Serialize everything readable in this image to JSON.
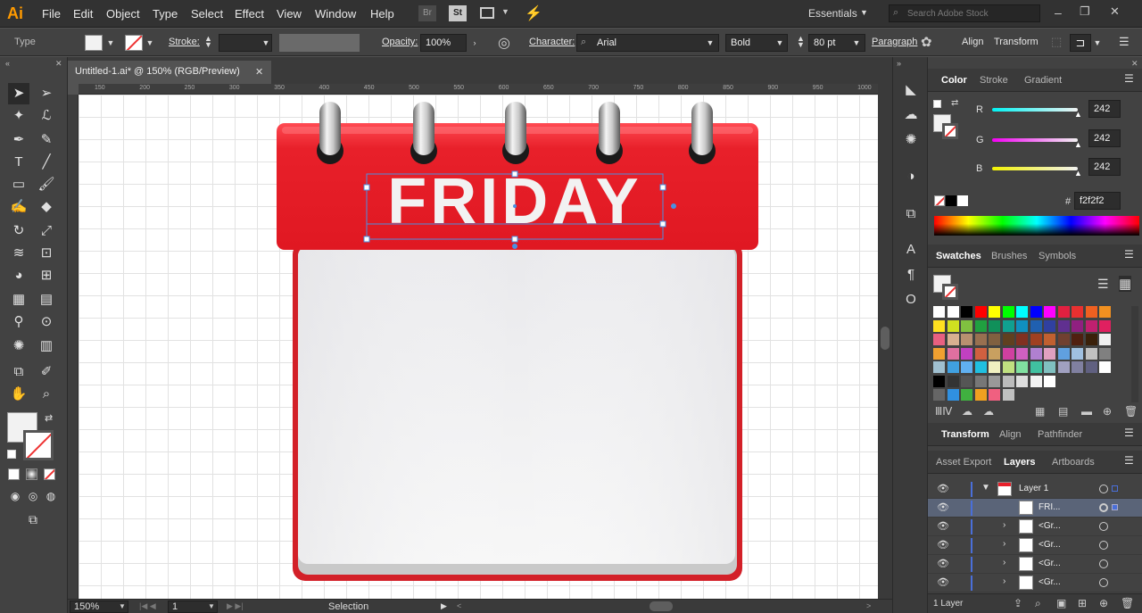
{
  "app": {
    "logo": "Ai"
  },
  "menu": [
    "File",
    "Edit",
    "Object",
    "Type",
    "Select",
    "Effect",
    "View",
    "Window",
    "Help"
  ],
  "menubar_icons": {
    "bridge": "Br",
    "stock": "St"
  },
  "workspace": {
    "label": "Essentials",
    "search_placeholder": "Search Adobe Stock"
  },
  "control": {
    "selection_type": "Type",
    "stroke_label": "Stroke:",
    "opacity_label": "Opacity:",
    "opacity_value": "100%",
    "character_label": "Character:",
    "font_family": "Arial",
    "font_style": "Bold",
    "font_size": "80 pt",
    "paragraph_label": "Paragraph",
    "align_label": "Align",
    "transform_label": "Transform"
  },
  "document": {
    "tab_title": "Untitled-1.ai* @ 150% (RGB/Preview)",
    "close": "✕"
  },
  "ruler_ticks": [
    "150",
    "200",
    "250",
    "300",
    "350",
    "400",
    "450",
    "500",
    "550",
    "600",
    "650",
    "700",
    "750",
    "800",
    "850",
    "900",
    "950",
    "1000"
  ],
  "artwork": {
    "calendar_text": "FRIDAY"
  },
  "status": {
    "zoom": "150%",
    "artboard": "1",
    "tool": "Selection"
  },
  "color_panel": {
    "tabs": [
      "Color",
      "Stroke",
      "Gradient"
    ],
    "r_label": "R",
    "g_label": "G",
    "b_label": "B",
    "r": "242",
    "g": "242",
    "b": "242",
    "hex_label": "#",
    "hex": "f2f2f2"
  },
  "swatches_panel": {
    "tabs": [
      "Swatches",
      "Brushes",
      "Symbols"
    ]
  },
  "transform_panel": {
    "tabs": [
      "Transform",
      "Align",
      "Pathfinder"
    ]
  },
  "layers_panel": {
    "tabs": [
      "Asset Export",
      "Layers",
      "Artboards"
    ],
    "rows": [
      {
        "name": "Layer 1"
      },
      {
        "name": "FRI..."
      },
      {
        "name": "<Gr..."
      },
      {
        "name": "<Gr..."
      },
      {
        "name": "<Gr..."
      },
      {
        "name": "<Gr..."
      }
    ],
    "footer": "1 Layer"
  },
  "colors": {
    "accent_red": "#e8202a",
    "ui_dark": "#323232",
    "panel": "#424242",
    "selection": "#4a90e2"
  }
}
